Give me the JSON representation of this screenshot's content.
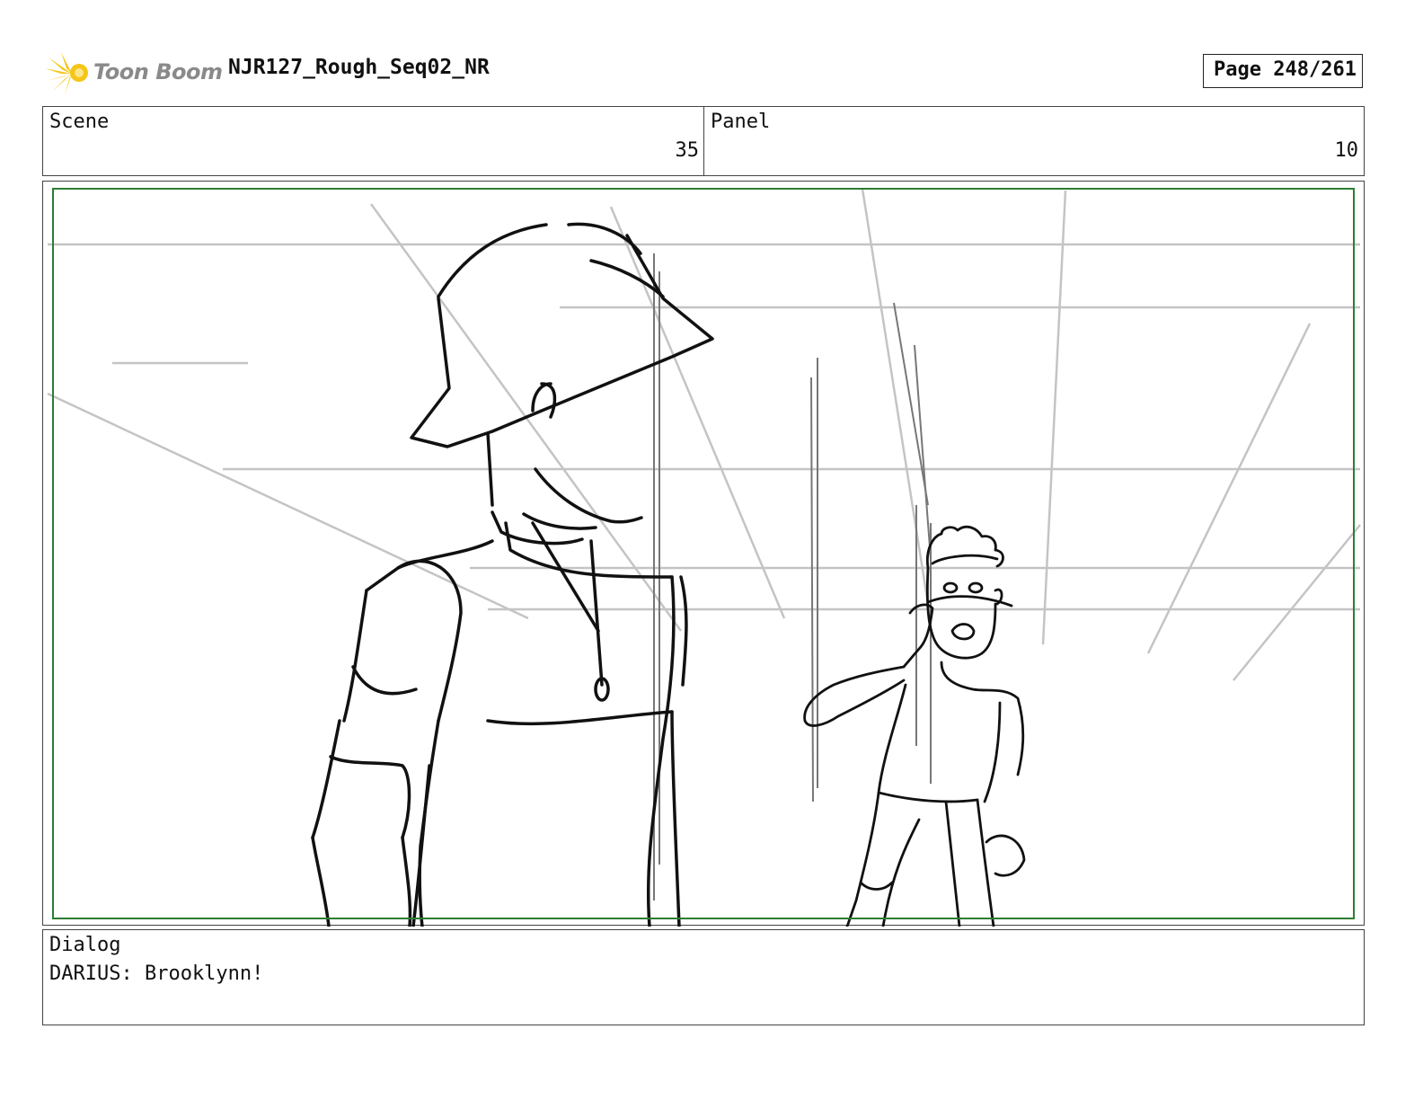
{
  "header": {
    "logo_text": "Toon Boom",
    "document_title": "NJR127_Rough_Seq02_NR",
    "page_indicator": "Page 248/261"
  },
  "info": {
    "scene_label": "Scene",
    "scene_value": "35",
    "panel_label": "Panel",
    "panel_value": "10"
  },
  "dialog": {
    "label": "Dialog",
    "text": "DARIUS: Brooklynn!"
  },
  "colors": {
    "logo_burst": "#f5c518",
    "logo_text": "#8a8a8a",
    "safe_frame": "#2e7d32",
    "guide_lines": "#bdbdbd",
    "ink": "#111111"
  }
}
